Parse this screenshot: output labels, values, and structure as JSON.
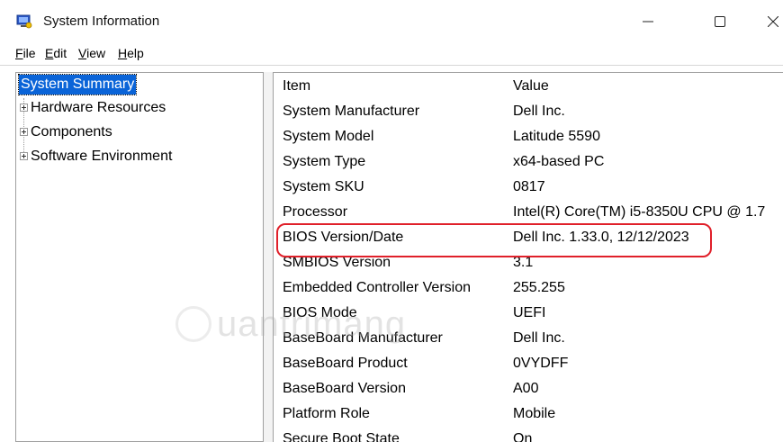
{
  "window": {
    "title": "System Information"
  },
  "menu": [
    {
      "key": "F",
      "rest": "ile"
    },
    {
      "key": "E",
      "rest": "dit"
    },
    {
      "key": "V",
      "rest": "iew"
    },
    {
      "key": "H",
      "rest": "elp"
    }
  ],
  "tree": {
    "root": "System Summary",
    "children": [
      "Hardware Resources",
      "Components",
      "Software Environment"
    ]
  },
  "table": {
    "headers": {
      "item": "Item",
      "value": "Value"
    },
    "rows": [
      {
        "item": "System Manufacturer",
        "value": "Dell Inc."
      },
      {
        "item": "System Model",
        "value": "Latitude 5590"
      },
      {
        "item": "System Type",
        "value": "x64-based PC"
      },
      {
        "item": "System SKU",
        "value": "0817"
      },
      {
        "item": "Processor",
        "value": "Intel(R) Core(TM) i5-8350U CPU @ 1.7"
      },
      {
        "item": "BIOS Version/Date",
        "value": "Dell Inc. 1.33.0, 12/12/2023"
      },
      {
        "item": "SMBIOS Version",
        "value": "3.1"
      },
      {
        "item": "Embedded Controller Version",
        "value": "255.255"
      },
      {
        "item": "BIOS Mode",
        "value": "UEFI"
      },
      {
        "item": "BaseBoard Manufacturer",
        "value": "Dell Inc."
      },
      {
        "item": "BaseBoard Product",
        "value": "0VYDFF"
      },
      {
        "item": "BaseBoard Version",
        "value": "A00"
      },
      {
        "item": "Platform Role",
        "value": "Mobile"
      },
      {
        "item": "Secure Boot State",
        "value": "On"
      }
    ]
  },
  "watermark": {
    "text": "uantrimang"
  },
  "colors": {
    "selection": "#0a64d8",
    "highlight": "#e0202a"
  }
}
